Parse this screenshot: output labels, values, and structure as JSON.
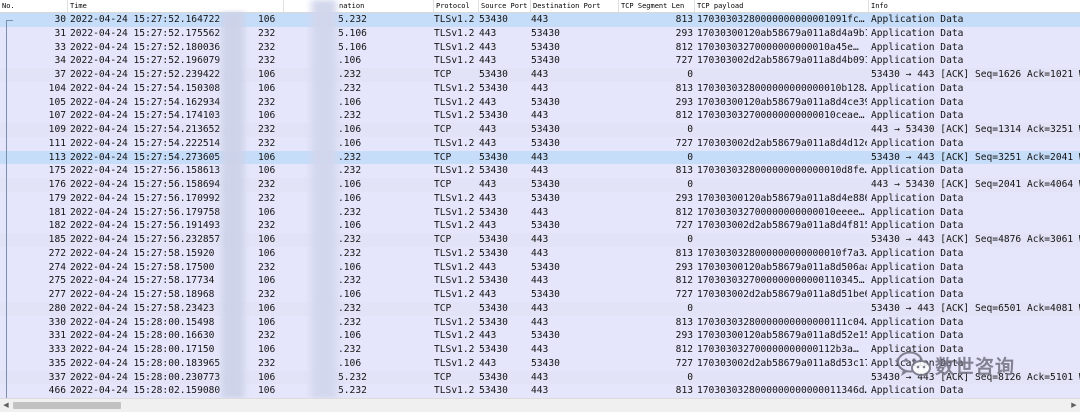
{
  "columns": {
    "no": "No.",
    "time": "Time",
    "destination": "nation",
    "protocol": "Protocol",
    "source_port": "Source Port",
    "destination_port": "Destination Port",
    "tcp_segment_len": "TCP Segment Len",
    "tcp_payload": "TCP payload",
    "info": "Info"
  },
  "packets": [
    {
      "no": "30",
      "time": "2022-04-24 15:27:52.164722",
      "src": "106",
      "dst": "5.232",
      "proto": "TLSv1.2",
      "sport": "53430",
      "dport": "443",
      "len": "813",
      "payload": "17030303280000000000001091fc…",
      "info": "Application Data",
      "selected": true
    },
    {
      "no": "31",
      "time": "2022-04-24 15:27:52.175562",
      "src": "232",
      "dst": "5.106",
      "proto": "TLSv1.2",
      "sport": "443",
      "dport": "53430",
      "len": "293",
      "payload": "17030300120ab58679a011a8d4a9b1…",
      "info": "Application Data"
    },
    {
      "no": "33",
      "time": "2022-04-24 15:27:52.180036",
      "src": "232",
      "dst": "5.106",
      "proto": "TLSv1.2",
      "sport": "443",
      "dport": "53430",
      "len": "812",
      "payload": "17030303270000000000010a45e…",
      "info": "Application Data"
    },
    {
      "no": "34",
      "time": "2022-04-24 15:27:52.196079",
      "src": "232",
      "dst": ".106",
      "proto": "TLSv1.2",
      "sport": "443",
      "dport": "53430",
      "len": "727",
      "payload": "170303002d2ab58679a011a8d4b091…",
      "info": "Application Data"
    },
    {
      "no": "37",
      "time": "2022-04-24 15:27:52.239422",
      "src": "106",
      "dst": ".232",
      "proto": "TCP",
      "sport": "53430",
      "dport": "443",
      "len": "0",
      "payload": "",
      "info": "53430 → 443 [ACK] Seq=1626 Ack=1021 Wi"
    },
    {
      "no": "104",
      "time": "2022-04-24 15:27:54.150308",
      "src": "106",
      "dst": ".232",
      "proto": "TLSv1.2",
      "sport": "53430",
      "dport": "443",
      "len": "813",
      "payload": "1703030328000000000000010b128…",
      "info": "Application Data"
    },
    {
      "no": "105",
      "time": "2022-04-24 15:27:54.162934",
      "src": "232",
      "dst": ".106",
      "proto": "TLSv1.2",
      "sport": "443",
      "dport": "53430",
      "len": "293",
      "payload": "17030300120ab58679a011a8d4ce39…",
      "info": "Application Data"
    },
    {
      "no": "107",
      "time": "2022-04-24 15:27:54.174103",
      "src": "106",
      "dst": ".232",
      "proto": "TLSv1.2",
      "sport": "53430",
      "dport": "443",
      "len": "812",
      "payload": "170303032700000000000010ceae…",
      "info": "Application Data"
    },
    {
      "no": "109",
      "time": "2022-04-24 15:27:54.213652",
      "src": "232",
      "dst": ".106",
      "proto": "TCP",
      "sport": "443",
      "dport": "53430",
      "len": "0",
      "payload": "",
      "info": "443 → 53430 [ACK] Seq=1314 Ack=3251 Wi"
    },
    {
      "no": "111",
      "time": "2022-04-24 15:27:54.222514",
      "src": "232",
      "dst": ".106",
      "proto": "TLSv1.2",
      "sport": "443",
      "dport": "53430",
      "len": "727",
      "payload": "170303002d2ab58679a011a8d4d12e…",
      "info": "Application Data"
    },
    {
      "no": "113",
      "time": "2022-04-24 15:27:54.273605",
      "src": "106",
      "dst": ".232",
      "proto": "TCP",
      "sport": "53430",
      "dport": "443",
      "len": "0",
      "payload": "",
      "info": "53430 → 443 [ACK] Seq=3251 Ack=2041 Wi",
      "selected": true
    },
    {
      "no": "175",
      "time": "2022-04-24 15:27:56.158613",
      "src": "106",
      "dst": ".232",
      "proto": "TLSv1.2",
      "sport": "53430",
      "dport": "443",
      "len": "813",
      "payload": "1703030328000000000000010d8fe…",
      "info": "Application Data"
    },
    {
      "no": "176",
      "time": "2022-04-24 15:27:56.158694",
      "src": "232",
      "dst": ".106",
      "proto": "TCP",
      "sport": "443",
      "dport": "53430",
      "len": "0",
      "payload": "",
      "info": "443 → 53430 [ACK] Seq=2041 Ack=4064 Wi"
    },
    {
      "no": "179",
      "time": "2022-04-24 15:27:56.170992",
      "src": "232",
      "dst": ".106",
      "proto": "TLSv1.2",
      "sport": "443",
      "dport": "53430",
      "len": "293",
      "payload": "17030300120ab58679a011a8d4e886…",
      "info": "Application Data"
    },
    {
      "no": "181",
      "time": "2022-04-24 15:27:56.179758",
      "src": "106",
      "dst": ".232",
      "proto": "TLSv1.2",
      "sport": "53430",
      "dport": "443",
      "len": "812",
      "payload": "170303032700000000000010eeee…",
      "info": "Application Data"
    },
    {
      "no": "182",
      "time": "2022-04-24 15:27:56.191493",
      "src": "232",
      "dst": ".106",
      "proto": "TLSv1.2",
      "sport": "443",
      "dport": "53430",
      "len": "727",
      "payload": "170303002d2ab58679a011a8d4f815…",
      "info": "Application Data"
    },
    {
      "no": "185",
      "time": "2022-04-24 15:27:56.232857",
      "src": "106",
      "dst": ".232",
      "proto": "TCP",
      "sport": "53430",
      "dport": "443",
      "len": "0",
      "payload": "",
      "info": "53430 → 443 [ACK] Seq=4876 Ack=3061 Wi"
    },
    {
      "no": "272",
      "time": "2022-04-24 15:27:58.15920",
      "src": "106",
      "dst": ".232",
      "proto": "TLSv1.2",
      "sport": "53430",
      "dport": "443",
      "len": "813",
      "payload": "1703030328000000000000010f7a3…",
      "info": "Application Data"
    },
    {
      "no": "274",
      "time": "2022-04-24 15:27:58.17500",
      "src": "232",
      "dst": ".106",
      "proto": "TLSv1.2",
      "sport": "443",
      "dport": "53430",
      "len": "293",
      "payload": "17030300120ab58679a011a8d506aa…",
      "info": "Application Data"
    },
    {
      "no": "275",
      "time": "2022-04-24 15:27:58.17734",
      "src": "106",
      "dst": ".232",
      "proto": "TLSv1.2",
      "sport": "53430",
      "dport": "443",
      "len": "812",
      "payload": "1703030327000000000000110345…",
      "info": "Application Data"
    },
    {
      "no": "277",
      "time": "2022-04-24 15:27:58.18968",
      "src": "232",
      "dst": ".106",
      "proto": "TLSv1.2",
      "sport": "443",
      "dport": "53430",
      "len": "727",
      "payload": "170303002d2ab58679a011a8d51be6…",
      "info": "Application Data"
    },
    {
      "no": "280",
      "time": "2022-04-24 15:27:58.23423",
      "src": "106",
      "dst": ".232",
      "proto": "TCP",
      "sport": "53430",
      "dport": "443",
      "len": "0",
      "payload": "",
      "info": "53430 → 443 [ACK] Seq=6501 Ack=4081 Wi"
    },
    {
      "no": "330",
      "time": "2022-04-24 15:28:00.15498",
      "src": "106",
      "dst": ".232",
      "proto": "TLSv1.2",
      "sport": "53430",
      "dport": "443",
      "len": "813",
      "payload": "17030303280000000000000111c04…",
      "info": "Application Data"
    },
    {
      "no": "331",
      "time": "2022-04-24 15:28:00.16630",
      "src": "232",
      "dst": ".106",
      "proto": "TLSv1.2",
      "sport": "443",
      "dport": "53430",
      "len": "293",
      "payload": "17030300120ab58679a011a8d52e15…",
      "info": "Application Data"
    },
    {
      "no": "333",
      "time": "2022-04-24 15:28:00.17150",
      "src": "106",
      "dst": ".232",
      "proto": "TLSv1.2",
      "sport": "53430",
      "dport": "443",
      "len": "812",
      "payload": "170303032700000000000112b3a…",
      "info": "Application Data"
    },
    {
      "no": "335",
      "time": "2022-04-24 15:28:00.183965",
      "src": "232",
      "dst": ".106",
      "proto": "TLSv1.2",
      "sport": "443",
      "dport": "53430",
      "len": "727",
      "payload": "170303002d2ab58679a011a8d53c17…",
      "info": "Application Data"
    },
    {
      "no": "337",
      "time": "2022-04-24 15:28:00.230773",
      "src": "106",
      "dst": "5.232",
      "proto": "TCP",
      "sport": "53430",
      "dport": "443",
      "len": "0",
      "payload": "",
      "info": "53430 → 443 [ACK] Seq=8126 Ack=5101 Wi"
    },
    {
      "no": "466",
      "time": "2022-04-24 15:28:02.159080",
      "src": "106",
      "dst": "5.232",
      "proto": "TLSv1.2",
      "sport": "53430",
      "dport": "443",
      "len": "813",
      "payload": "1703030328000000000000011346d…",
      "info": "Application Data"
    }
  ],
  "watermark": {
    "text": "数世咨询",
    "icon": "wechat-logo-icon"
  },
  "scrollbar": {
    "left_arrow": "◀",
    "right_arrow": "▶"
  }
}
